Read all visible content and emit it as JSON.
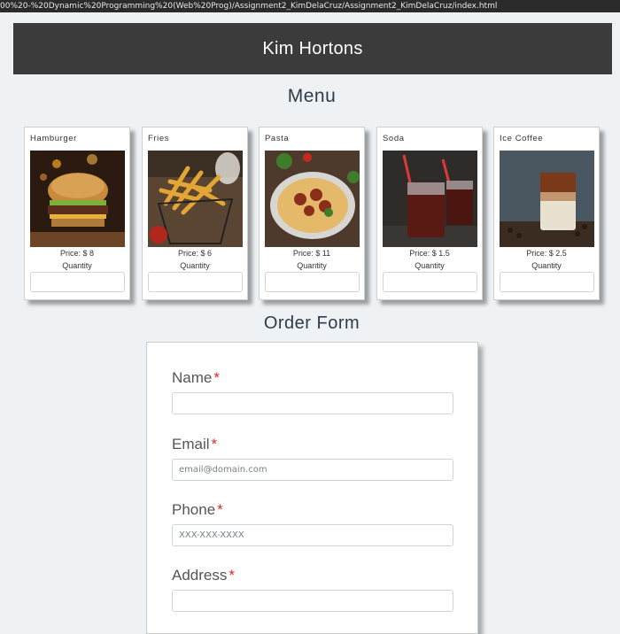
{
  "browser": {
    "url": "00%20-%20Dynamic%20Programming%20(Web%20Prog)/Assignment2_KimDelaCruz/Assignment2_KimDelaCruz/index.html"
  },
  "header": {
    "title": "Kim Hortons"
  },
  "menu": {
    "title": "Menu",
    "items": [
      {
        "name": "Hamburger",
        "price": "Price: $ 8",
        "quantity_label": "Quantity"
      },
      {
        "name": "Fries",
        "price": "Price: $ 6",
        "quantity_label": "Quantity"
      },
      {
        "name": "Pasta",
        "price": "Price: $ 11",
        "quantity_label": "Quantity"
      },
      {
        "name": "Soda",
        "price": "Price: $ 1.5",
        "quantity_label": "Quantity"
      },
      {
        "name": "Ice Coffee",
        "price": "Price: $ 2.5",
        "quantity_label": "Quantity"
      }
    ]
  },
  "order_form": {
    "title": "Order Form",
    "required_marker": "*",
    "fields": [
      {
        "label": "Name",
        "placeholder": ""
      },
      {
        "label": "Email",
        "placeholder": "email@domain.com"
      },
      {
        "label": "Phone",
        "placeholder": "XXX-XXX-XXXX"
      },
      {
        "label": "Address",
        "placeholder": ""
      }
    ]
  },
  "colors": {
    "page_background": "#eef2f5",
    "header_background": "#3b3b3b",
    "required_marker": "#e0262b",
    "heading_text": "#2e3d49"
  }
}
